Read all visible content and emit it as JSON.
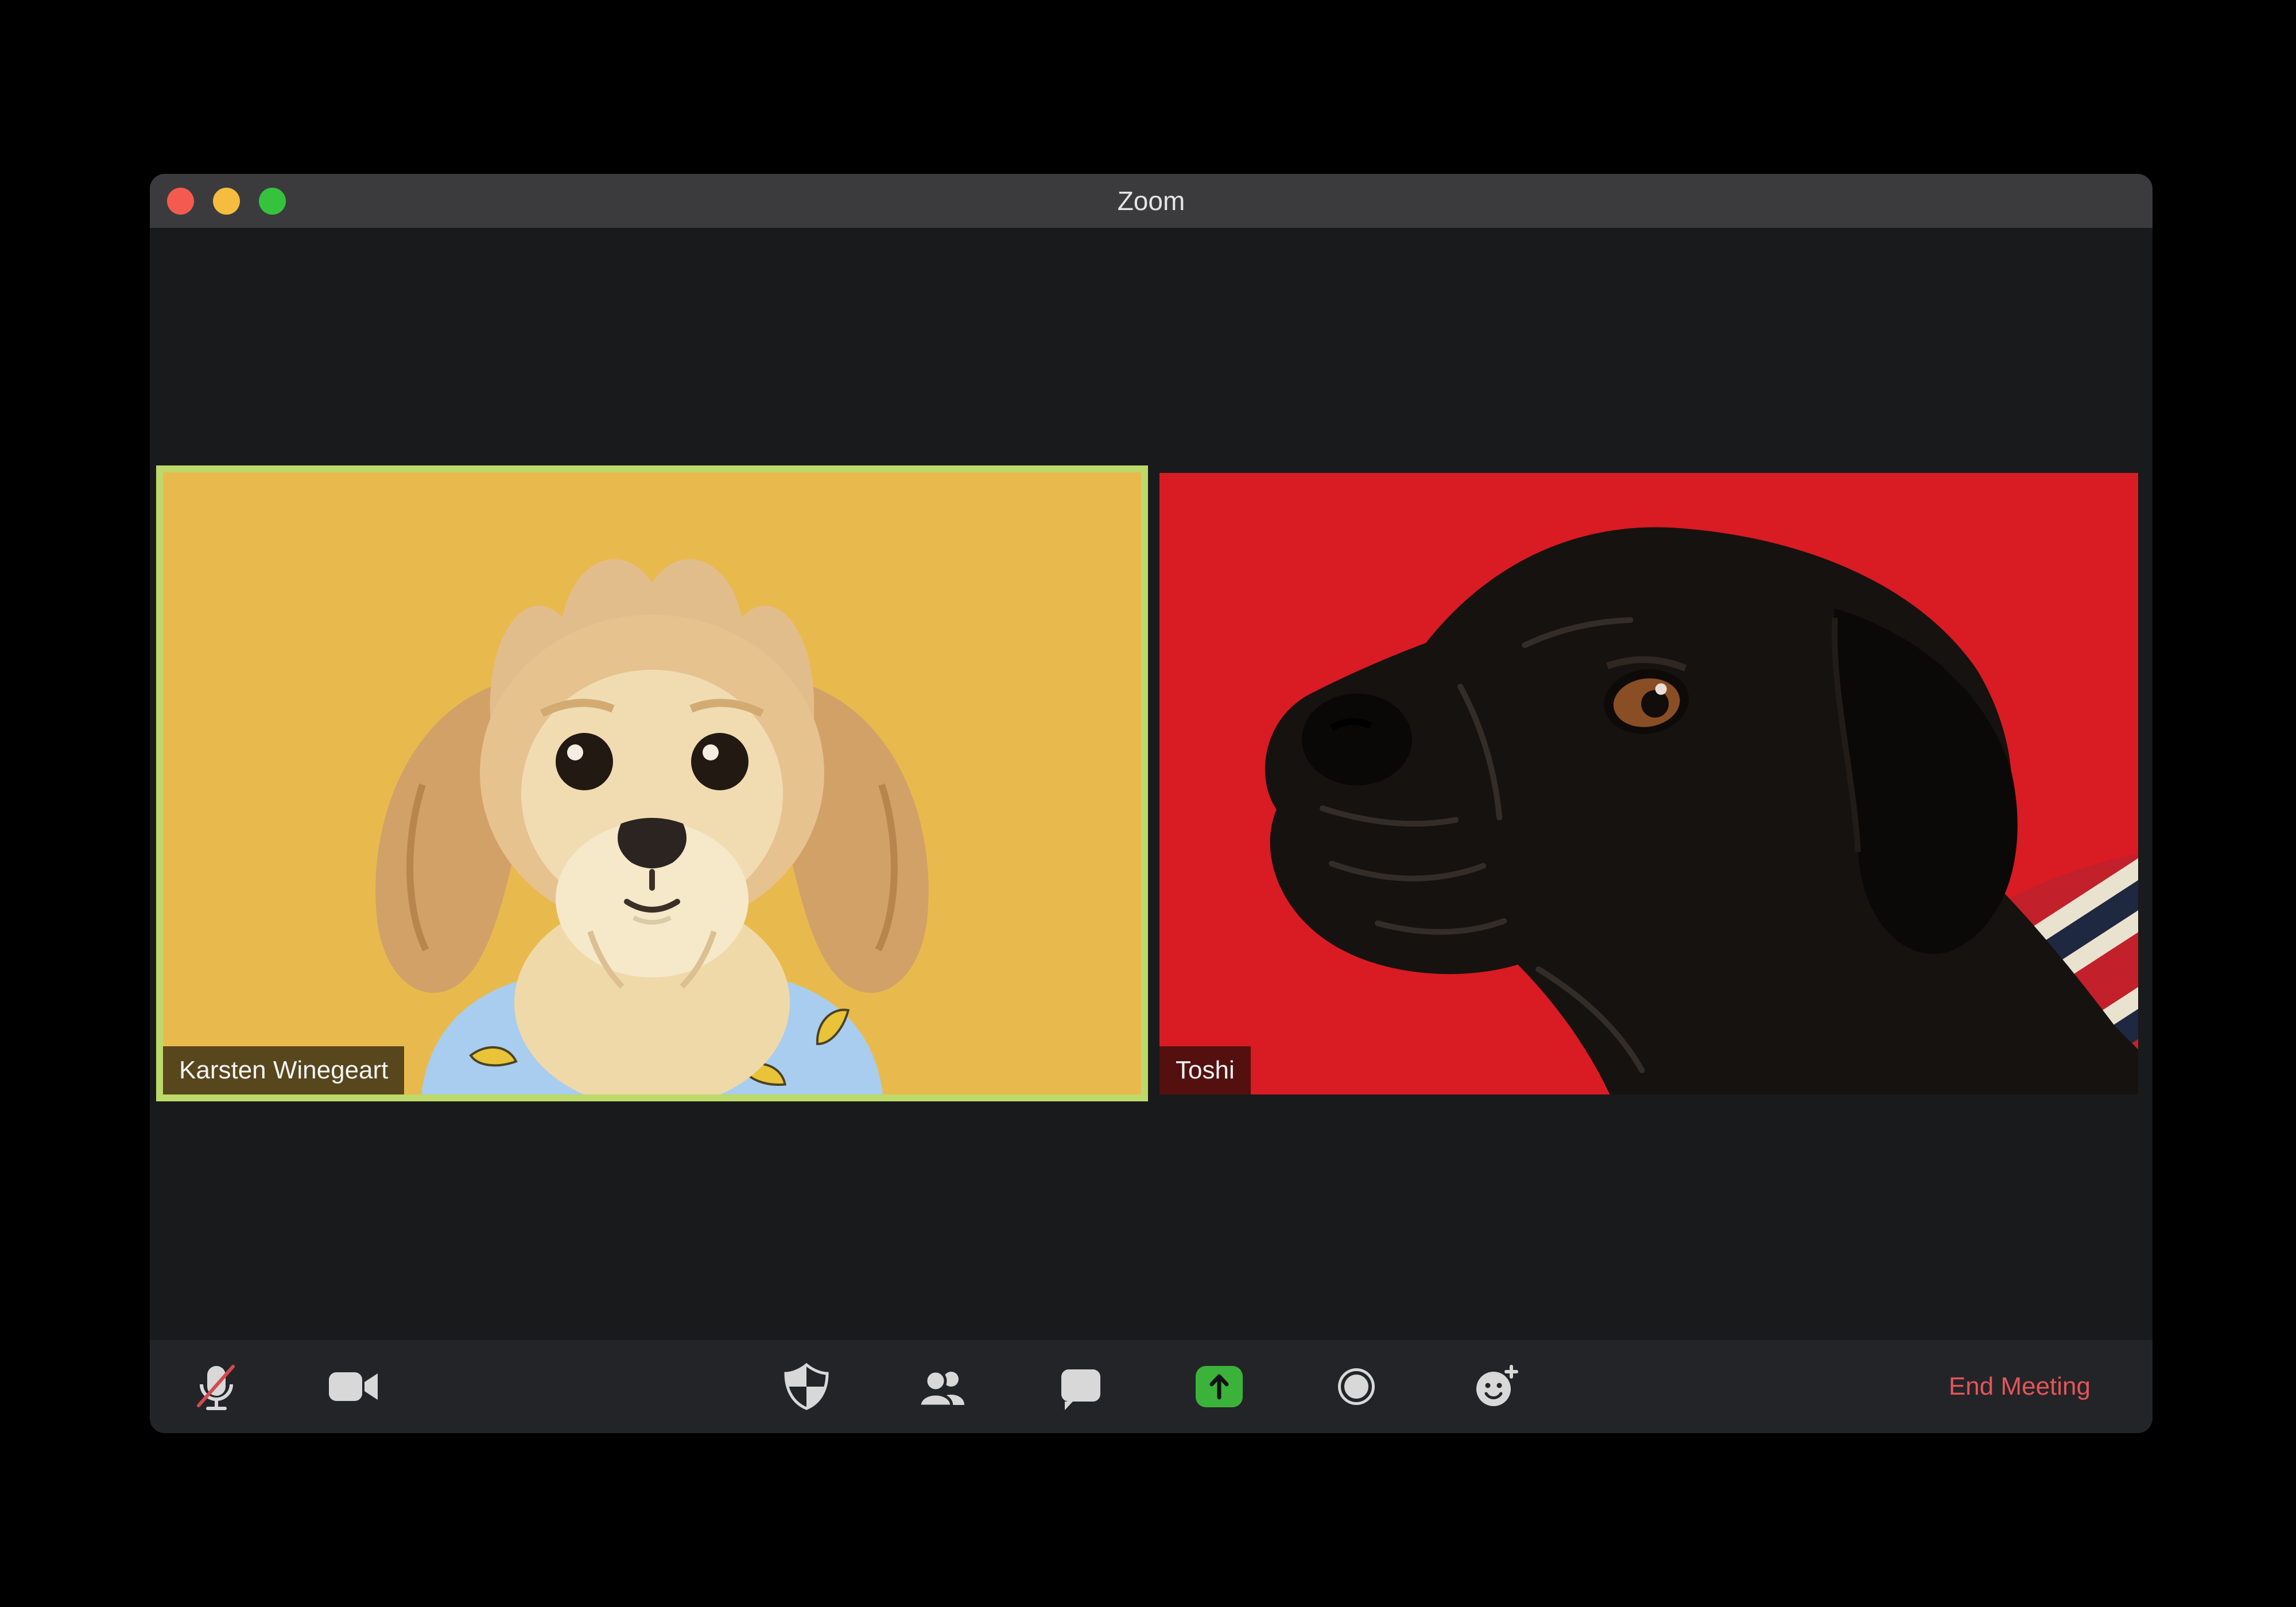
{
  "window": {
    "title": "Zoom",
    "traffic_lights": [
      {
        "name": "close",
        "color": "#f45a50"
      },
      {
        "name": "minimize",
        "color": "#f6bc3f"
      },
      {
        "name": "fullscreen",
        "color": "#35c33e"
      }
    ]
  },
  "participants": [
    {
      "name": "Karsten Winegeart",
      "active_speaker": true,
      "video_background": "#e8ba4e",
      "subject": "tan fluffy dog in blue banana shirt"
    },
    {
      "name": "Toshi",
      "active_speaker": false,
      "video_background": "#d91b24",
      "subject": "black pug in striped sweater"
    }
  ],
  "toolbar": {
    "icons": [
      {
        "name": "mic-off-icon",
        "state": "muted"
      },
      {
        "name": "video-camera-icon",
        "state": "on"
      },
      {
        "name": "security-shield-icon"
      },
      {
        "name": "participants-icon"
      },
      {
        "name": "chat-icon"
      },
      {
        "name": "share-screen-icon",
        "accent": "#3bb33a"
      },
      {
        "name": "record-icon"
      },
      {
        "name": "reactions-icon"
      }
    ],
    "end_meeting_label": "End Meeting"
  },
  "colors": {
    "active_speaker_border": "#bcd969",
    "end_meeting_text": "#e2555a",
    "mic_slash": "#d2494f",
    "icon": "#d8d8d8",
    "titlebar_bg": "#3b3b3d",
    "toolbar_bg": "#232427",
    "stage_bg": "#191a1c"
  }
}
